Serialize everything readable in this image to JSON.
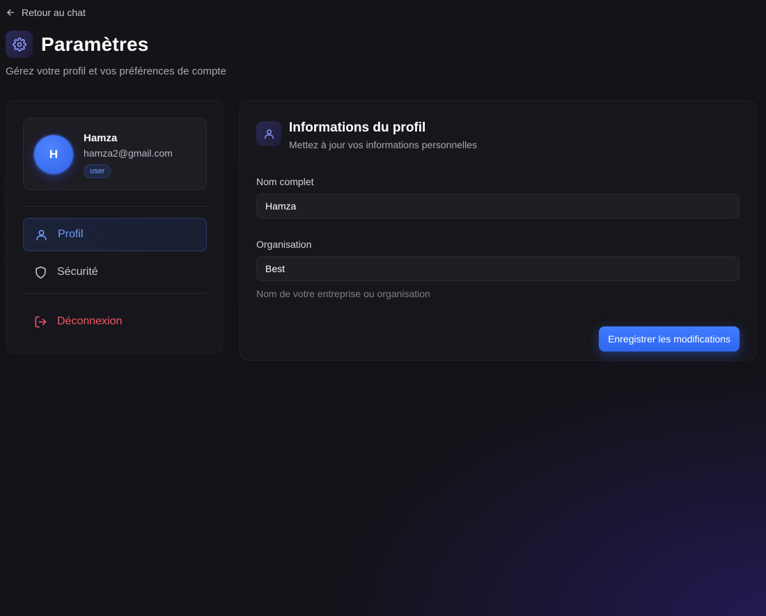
{
  "nav": {
    "back_label": "Retour au chat"
  },
  "header": {
    "title": "Paramètres",
    "subtitle": "Gérez votre profil et vos préférences de compte"
  },
  "user": {
    "initial": "H",
    "name": "Hamza",
    "email": "hamza2@gmail.com",
    "role": "user"
  },
  "sidebar": {
    "items": [
      {
        "label": "Profil",
        "icon": "user-icon",
        "active": true
      },
      {
        "label": "Sécurité",
        "icon": "shield-icon",
        "active": false
      }
    ],
    "logout_label": "Déconnexion"
  },
  "profile": {
    "title": "Informations du profil",
    "subtitle": "Mettez à jour vos informations personnelles",
    "fields": [
      {
        "label": "Nom complet",
        "value": "Hamza"
      },
      {
        "label": "Organisation",
        "value": "Best",
        "help": "Nom de votre entreprise ou organisation"
      }
    ],
    "save_label": "Enregistrer les modifications"
  },
  "colors": {
    "accent": "#3f7cff",
    "active_nav_text": "#6f9bff",
    "logout": "#ef5a6a",
    "background": "#141318"
  }
}
